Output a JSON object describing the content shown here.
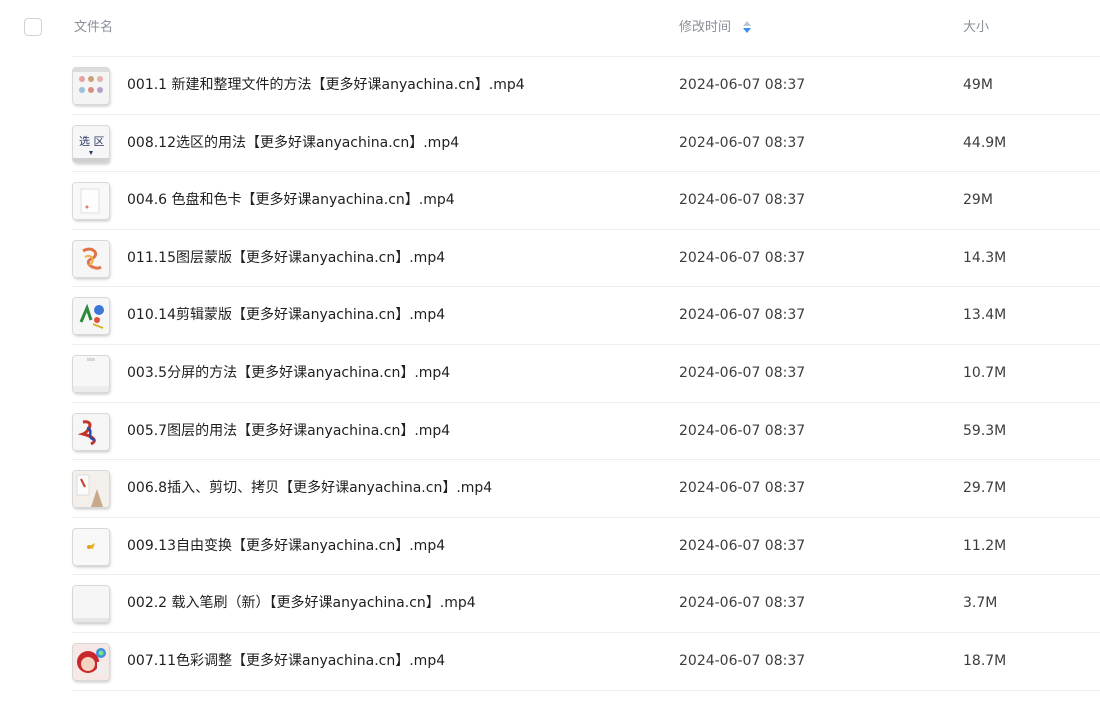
{
  "header": {
    "name_label": "文件名",
    "time_label": "修改时间",
    "size_label": "大小",
    "sort_up_color": "#b9c4d6",
    "sort_down_color": "#3b8ef0"
  },
  "files": [
    {
      "name": "001.1 新建和整理文件的方法【更多好课anyachina.cn】.mp4",
      "time": "2024-06-07 08:37",
      "size": "49M",
      "thumb_icon": "video-thumbnail-icon"
    },
    {
      "name": "008.12选区的用法【更多好课anyachina.cn】.mp4",
      "time": "2024-06-07 08:37",
      "size": "44.9M",
      "thumb_icon": "video-thumbnail-icon"
    },
    {
      "name": "004.6 色盘和色卡【更多好课anyachina.cn】.mp4",
      "time": "2024-06-07 08:37",
      "size": "29M",
      "thumb_icon": "video-thumbnail-icon"
    },
    {
      "name": "011.15图层蒙版【更多好课anyachina.cn】.mp4",
      "time": "2024-06-07 08:37",
      "size": "14.3M",
      "thumb_icon": "video-thumbnail-icon"
    },
    {
      "name": "010.14剪辑蒙版【更多好课anyachina.cn】.mp4",
      "time": "2024-06-07 08:37",
      "size": "13.4M",
      "thumb_icon": "video-thumbnail-icon"
    },
    {
      "name": "003.5分屏的方法【更多好课anyachina.cn】.mp4",
      "time": "2024-06-07 08:37",
      "size": "10.7M",
      "thumb_icon": "video-thumbnail-icon"
    },
    {
      "name": "005.7图层的用法【更多好课anyachina.cn】.mp4",
      "time": "2024-06-07 08:37",
      "size": "59.3M",
      "thumb_icon": "video-thumbnail-icon"
    },
    {
      "name": "006.8插入、剪切、拷贝【更多好课anyachina.cn】.mp4",
      "time": "2024-06-07 08:37",
      "size": "29.7M",
      "thumb_icon": "video-thumbnail-icon"
    },
    {
      "name": "009.13自由变换【更多好课anyachina.cn】.mp4",
      "time": "2024-06-07 08:37",
      "size": "11.2M",
      "thumb_icon": "video-thumbnail-icon"
    },
    {
      "name": "002.2 载入笔刷（新）【更多好课anyachina.cn】.mp4",
      "time": "2024-06-07 08:37",
      "size": "3.7M",
      "thumb_icon": "video-thumbnail-icon"
    },
    {
      "name": "007.11色彩调整【更多好课anyachina.cn】.mp4",
      "time": "2024-06-07 08:37",
      "size": "18.7M",
      "thumb_icon": "video-thumbnail-icon"
    }
  ]
}
